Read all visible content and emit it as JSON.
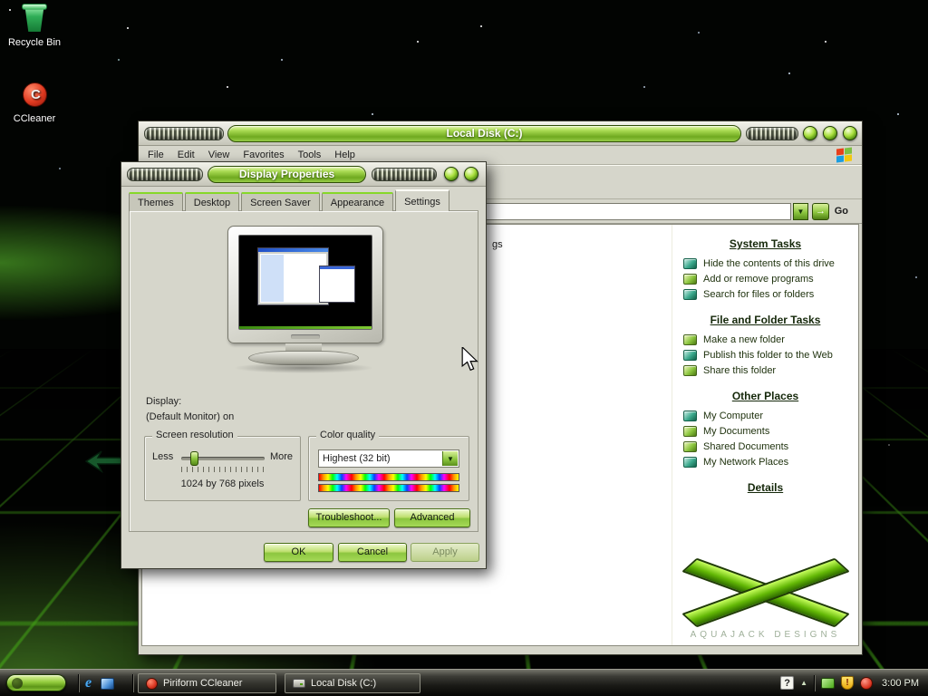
{
  "theme": {
    "accent_green": "#8CC63F",
    "accent_dark_green": "#4E7A14",
    "titlebar_text": "#FFFFFF",
    "desktop_grid_green": "#49E20E"
  },
  "desktop": {
    "icons": [
      {
        "name": "recycle-bin",
        "label": "Recycle Bin"
      },
      {
        "name": "ccleaner",
        "label": "CCleaner"
      }
    ]
  },
  "explorer": {
    "title": "Local Disk (C:)",
    "window_buttons": [
      "minimize",
      "maximize",
      "close"
    ],
    "menu": [
      "File",
      "Edit",
      "View",
      "Favorites",
      "Tools",
      "Help"
    ],
    "address": {
      "value": "",
      "go_label": "Go"
    },
    "partial_item_text": "gs",
    "task_panes": {
      "system_tasks": {
        "title": "System Tasks",
        "items": [
          {
            "icon": "drive-icon",
            "label": "Hide the contents of this drive"
          },
          {
            "icon": "add-remove-programs-icon",
            "label": "Add or remove programs"
          },
          {
            "icon": "search-icon",
            "label": "Search for files or folders"
          }
        ]
      },
      "file_folder_tasks": {
        "title": "File and Folder Tasks",
        "items": [
          {
            "icon": "new-folder-icon",
            "label": "Make a new folder"
          },
          {
            "icon": "publish-web-icon",
            "label": "Publish this folder to the Web"
          },
          {
            "icon": "share-folder-icon",
            "label": "Share this folder"
          }
        ]
      },
      "other_places": {
        "title": "Other Places",
        "items": [
          {
            "icon": "my-computer-icon",
            "label": "My Computer"
          },
          {
            "icon": "my-documents-icon",
            "label": "My Documents"
          },
          {
            "icon": "shared-documents-icon",
            "label": "Shared Documents"
          },
          {
            "icon": "network-places-icon",
            "label": "My Network Places"
          }
        ]
      },
      "details": {
        "title": "Details"
      }
    },
    "watermark": "AQUAJACK DESIGNS"
  },
  "display_dialog": {
    "title": "Display Properties",
    "window_buttons": [
      "help",
      "close"
    ],
    "tabs": [
      "Themes",
      "Desktop",
      "Screen Saver",
      "Appearance",
      "Settings"
    ],
    "active_tab": "Settings",
    "display_label": "Display:",
    "display_value": "(Default Monitor) on",
    "screen_resolution": {
      "legend": "Screen resolution",
      "less": "Less",
      "more": "More",
      "value": "1024 by 768 pixels"
    },
    "color_quality": {
      "legend": "Color quality",
      "selected": "Highest (32 bit)"
    },
    "buttons": {
      "troubleshoot": "Troubleshoot...",
      "advanced": "Advanced",
      "ok": "OK",
      "cancel": "Cancel",
      "apply": "Apply"
    },
    "apply_enabled": false
  },
  "taskbar": {
    "start": {
      "name": "start-button"
    },
    "quick_launch": [
      "internet-explorer-icon",
      "launcher-icon"
    ],
    "tasks": [
      {
        "icon": "ccleaner-icon",
        "label": "Piriform CCleaner"
      },
      {
        "icon": "drive-icon",
        "label": "Local Disk (C:)"
      }
    ],
    "tray": {
      "icons": [
        "help-icon",
        "hide-icons-chevron-icon",
        "network-icon",
        "security-shield-icon",
        "alert-icon"
      ],
      "clock": "3:00 PM"
    }
  }
}
